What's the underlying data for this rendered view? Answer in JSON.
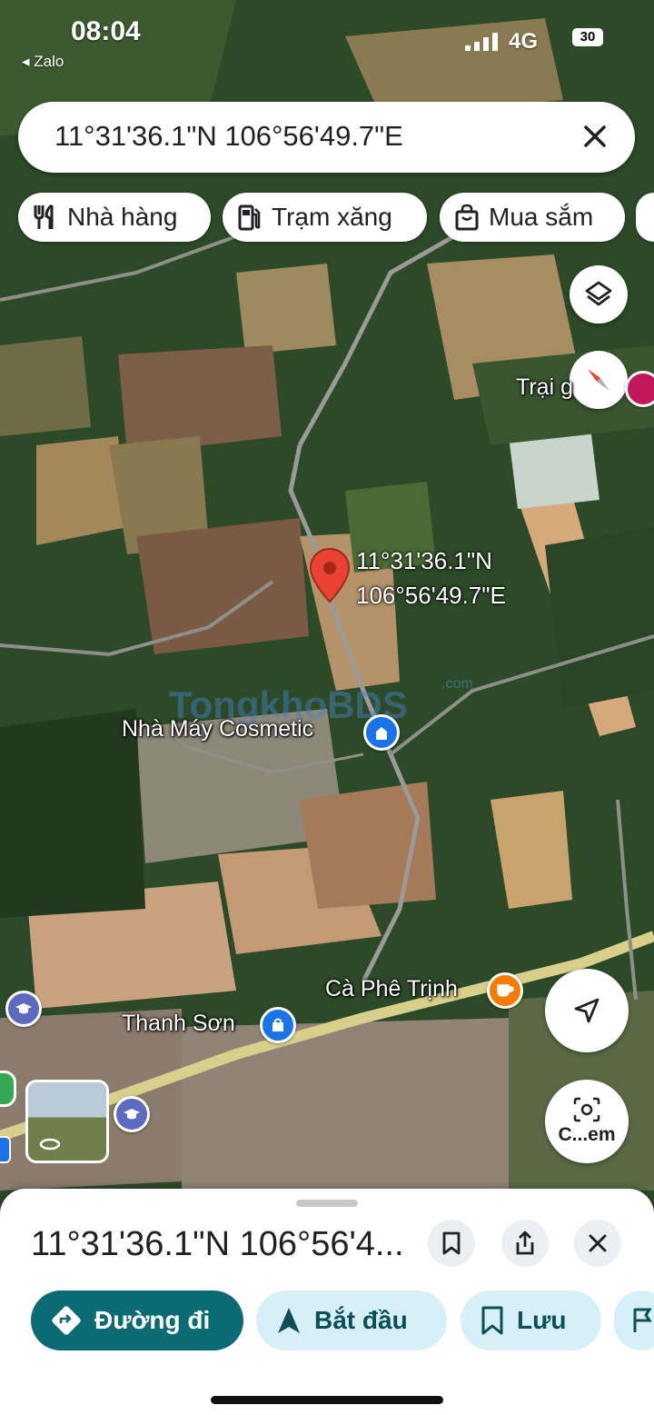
{
  "status_bar": {
    "time": "08:04",
    "back_app": "◂ Zalo",
    "network": "4G",
    "battery": "30"
  },
  "search": {
    "query": "11°31'36.1\"N 106°56'49.7\"E"
  },
  "chips": [
    {
      "label": "Nhà hàng",
      "icon": "restaurant-icon"
    },
    {
      "label": "Trạm xăng",
      "icon": "gas-station-icon"
    },
    {
      "label": "Mua sắm",
      "icon": "shopping-bag-icon"
    }
  ],
  "map": {
    "pin_label_lat": "11°31'36.1\"N",
    "pin_label_lng": "106°56'49.7\"E",
    "labels": {
      "trai": "Trại g",
      "factory": "Nhà Máy Cosmetic",
      "cafe": "Cà Phê Trịnh",
      "town": "Thanh Sơn"
    },
    "watermark": "TongkhoBDS",
    "watermark_domain": ".com"
  },
  "fab": {
    "lens_label": "C...em"
  },
  "sheet": {
    "title": "11°31'36.1\"N 106°56'4...",
    "actions": [
      {
        "label": "Đường đi",
        "icon": "directions-icon"
      },
      {
        "label": "Bắt đầu",
        "icon": "navigation-arrow-icon"
      },
      {
        "label": "Lưu",
        "icon": "bookmark-icon"
      }
    ]
  },
  "colors": {
    "primary": "#0b6b75",
    "action_bg": "#d7f0f7",
    "pin": "#ea4335",
    "poi_blue": "#1a73e8",
    "poi_orange": "#f57c00"
  }
}
